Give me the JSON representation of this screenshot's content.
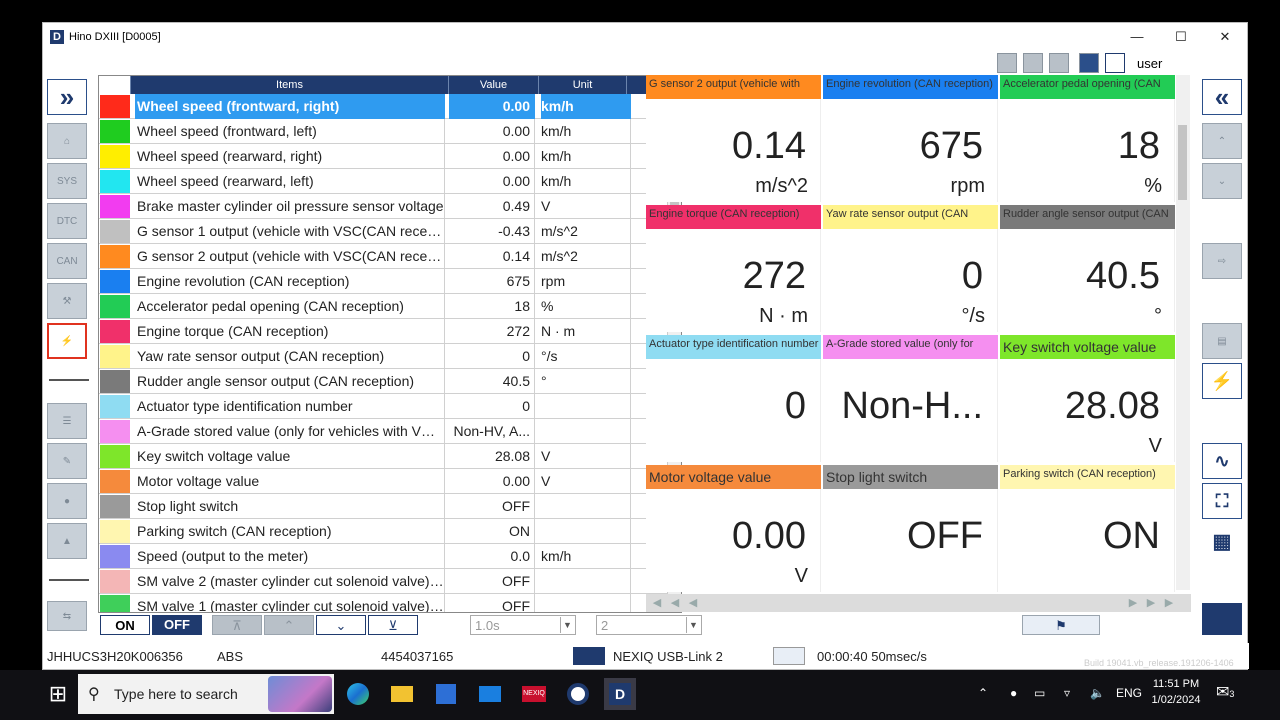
{
  "window": {
    "title": "Hino DXIII [D0005]",
    "user": "user"
  },
  "table": {
    "headers": {
      "items": "Items",
      "value": "Value",
      "unit": "Unit"
    },
    "rows": [
      {
        "name": "Wheel speed (frontward, right)",
        "value": "0.00",
        "unit": "km/h",
        "color": "#ff2a1a"
      },
      {
        "name": "Wheel speed (frontward, left)",
        "value": "0.00",
        "unit": "km/h",
        "color": "#1fcc1f"
      },
      {
        "name": "Wheel speed (rearward, right)",
        "value": "0.00",
        "unit": "km/h",
        "color": "#ffee00"
      },
      {
        "name": "Wheel speed (rearward, left)",
        "value": "0.00",
        "unit": "km/h",
        "color": "#22e6f0"
      },
      {
        "name": "Brake master cylinder oil pressure sensor voltage",
        "value": "0.49",
        "unit": "V",
        "color": "#f23cf0"
      },
      {
        "name": "G sensor 1 output (vehicle with VSC(CAN recepti...",
        "value": "-0.43",
        "unit": "m/s^2",
        "color": "#c0c0c0"
      },
      {
        "name": "G sensor 2 output (vehicle with VSC(CAN recepti...",
        "value": "0.14",
        "unit": "m/s^2",
        "color": "#ff8a1f"
      },
      {
        "name": "Engine revolution (CAN reception)",
        "value": "675",
        "unit": "rpm",
        "color": "#1a7ff0"
      },
      {
        "name": "Accelerator pedal opening (CAN reception)",
        "value": "18",
        "unit": "%",
        "color": "#22cc55"
      },
      {
        "name": "Engine torque (CAN reception)",
        "value": "272",
        "unit": "N · m",
        "color": "#f0306a"
      },
      {
        "name": "Yaw rate sensor output (CAN reception)",
        "value": "0",
        "unit": "°/s",
        "color": "#fff38a"
      },
      {
        "name": "Rudder angle sensor output (CAN reception)",
        "value": "40.5",
        "unit": "°",
        "color": "#7a7a7a"
      },
      {
        "name": "Actuator type identification number",
        "value": "0",
        "unit": "",
        "color": "#8fdcf2"
      },
      {
        "name": "A-Grade stored value (only for vehicles with VSC)",
        "value": "Non-HV, A...",
        "unit": "",
        "color": "#f58ff0"
      },
      {
        "name": "Key switch voltage value",
        "value": "28.08",
        "unit": "V",
        "color": "#7ee62a"
      },
      {
        "name": "Motor voltage value",
        "value": "0.00",
        "unit": "V",
        "color": "#f58a3c"
      },
      {
        "name": "Stop light switch",
        "value": "OFF",
        "unit": "",
        "color": "#9a9a9a"
      },
      {
        "name": "Parking switch (CAN reception)",
        "value": "ON",
        "unit": "",
        "color": "#fff6b0"
      },
      {
        "name": "Speed (output to the meter)",
        "value": "0.0",
        "unit": "km/h",
        "color": "#8a8af0"
      },
      {
        "name": "SM valve 2 (master cylinder cut solenoid valve) [r...",
        "value": "OFF",
        "unit": "",
        "color": "#f4b6b6"
      },
      {
        "name": "SM valve 1 (master cylinder cut solenoid valve) [f...",
        "value": "OFF",
        "unit": "",
        "color": "#3fcf5a"
      }
    ]
  },
  "tiles": [
    {
      "header": "G sensor 2 output (vehicle with",
      "value": "0.14",
      "unit": "m/s^2",
      "color": "#ff8a1f"
    },
    {
      "header": "Engine revolution (CAN reception)",
      "value": "675",
      "unit": "rpm",
      "color": "#1a7ff0"
    },
    {
      "header": "Accelerator pedal opening (CAN",
      "value": "18",
      "unit": "%",
      "color": "#22cc55"
    },
    {
      "header": "Engine torque (CAN reception)",
      "value": "272",
      "unit": "N · m",
      "color": "#f0306a"
    },
    {
      "header": "Yaw rate sensor output (CAN",
      "value": "0",
      "unit": "°/s",
      "color": "#fff38a"
    },
    {
      "header": "Rudder angle sensor output (CAN",
      "value": "40.5",
      "unit": "°",
      "color": "#7a7a7a"
    },
    {
      "header": "Actuator type identification number",
      "value": "0",
      "unit": "",
      "color": "#8fdcf2"
    },
    {
      "header": "A-Grade stored value (only for",
      "value": "Non-H...",
      "unit": "",
      "color": "#f58ff0"
    },
    {
      "header": "Key switch voltage value",
      "value": "28.08",
      "unit": "V",
      "color": "#7ee62a"
    },
    {
      "header": "Motor voltage value",
      "value": "0.00",
      "unit": "V",
      "color": "#f58a3c"
    },
    {
      "header": "Stop light switch",
      "value": "OFF",
      "unit": "",
      "color": "#9a9a9a"
    },
    {
      "header": "Parking switch (CAN reception)",
      "value": "ON",
      "unit": "",
      "color": "#fff6b0"
    }
  ],
  "controls": {
    "on": "ON",
    "off": "OFF",
    "interval": "1.0s",
    "count": "2"
  },
  "status": {
    "vin": "JHHUCS3H20K006356",
    "system": "ABS",
    "ecu_id": "4454037165",
    "interface": "NEXIQ USB-Link 2",
    "timer": "00:00:40 50msec/s"
  },
  "taskbar": {
    "search_placeholder": "Type here to search",
    "language": "ENG",
    "time": "11:51 PM",
    "date": "1/02/2024",
    "notification_count": "3",
    "build": "Build 19041.vb_release.191206-1406"
  }
}
